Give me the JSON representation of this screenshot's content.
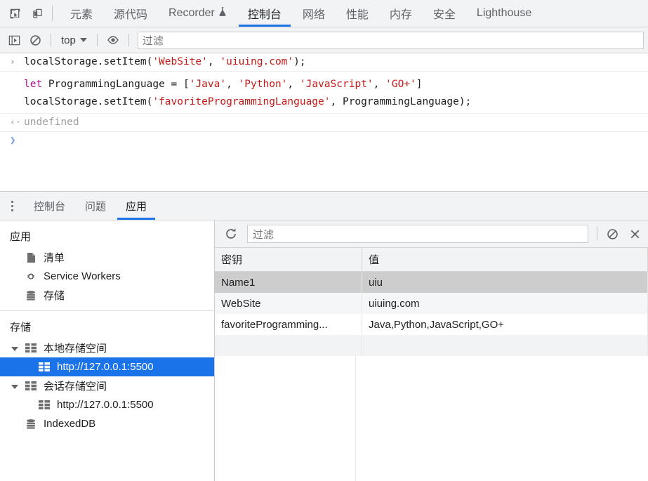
{
  "top_toolbar": {
    "inspect_icon": "inspect-cursor-icon",
    "device_icon": "device-toolbar-icon",
    "tabs": [
      {
        "label": "元素",
        "active": false
      },
      {
        "label": "源代码",
        "active": false
      },
      {
        "label": "Recorder",
        "active": false,
        "icon": "flask-experiment-icon"
      },
      {
        "label": "控制台",
        "active": true
      },
      {
        "label": "网络",
        "active": false
      },
      {
        "label": "性能",
        "active": false
      },
      {
        "label": "内存",
        "active": false
      },
      {
        "label": "安全",
        "active": false
      },
      {
        "label": "Lighthouse",
        "active": false
      }
    ]
  },
  "console_toolbar": {
    "sidebar_toggle_icon": "console-sidebar-icon",
    "clear_icon": "clear-console-icon",
    "context_value": "top",
    "eye_icon": "live-expression-eye-icon",
    "filter_placeholder": "过滤"
  },
  "console": {
    "entries": [
      {
        "kind": "input",
        "marker": "›",
        "tokens": [
          {
            "t": "localStorage.setItem(",
            "c": "plain"
          },
          {
            "t": "'WebSite'",
            "c": "str"
          },
          {
            "t": ", ",
            "c": "plain"
          },
          {
            "t": "'uiuing.com'",
            "c": "str"
          },
          {
            "t": ");",
            "c": "plain"
          }
        ]
      },
      {
        "kind": "input-multiline",
        "marker": "",
        "lines": [
          [
            {
              "t": "let",
              "c": "kw"
            },
            {
              "t": " ProgrammingLanguage = [",
              "c": "plain"
            },
            {
              "t": "'Java'",
              "c": "str"
            },
            {
              "t": ", ",
              "c": "plain"
            },
            {
              "t": "'Python'",
              "c": "str"
            },
            {
              "t": ", ",
              "c": "plain"
            },
            {
              "t": "'JavaScript'",
              "c": "str"
            },
            {
              "t": ", ",
              "c": "plain"
            },
            {
              "t": "'GO+'",
              "c": "str"
            },
            {
              "t": "]",
              "c": "plain"
            }
          ],
          [
            {
              "t": "localStorage.setItem(",
              "c": "plain"
            },
            {
              "t": "'favoriteProgrammingLanguage'",
              "c": "str"
            },
            {
              "t": ", ProgrammingLanguage);",
              "c": "plain"
            }
          ]
        ]
      },
      {
        "kind": "output",
        "marker": "‹·",
        "text": "undefined"
      }
    ],
    "prompt_marker": "❯"
  },
  "drawer": {
    "more_icon": "more-options-dots-icon",
    "tabs": [
      {
        "label": "控制台",
        "active": false
      },
      {
        "label": "问题",
        "active": false
      },
      {
        "label": "应用",
        "active": true
      }
    ]
  },
  "app_sidebar": {
    "section_application": {
      "title": "应用",
      "items": [
        {
          "label": "清单",
          "icon": "manifest-file-icon",
          "selected": false
        },
        {
          "label": "Service Workers",
          "icon": "gear-icon",
          "selected": false
        },
        {
          "label": "存储",
          "icon": "database-icon",
          "selected": false
        }
      ]
    },
    "section_storage": {
      "title": "存储",
      "items": [
        {
          "label": "本地存储空间",
          "icon": "table-grid-icon",
          "twisty": "expanded",
          "indent": 1,
          "selected": false
        },
        {
          "label": "http://127.0.0.1:5500",
          "icon": "table-grid-icon",
          "twisty": "none",
          "indent": 2,
          "selected": true
        },
        {
          "label": "会话存储空间",
          "icon": "table-grid-icon",
          "twisty": "expanded",
          "indent": 1,
          "selected": false
        },
        {
          "label": "http://127.0.0.1:5500",
          "icon": "table-grid-icon",
          "twisty": "none",
          "indent": 2,
          "selected": false
        },
        {
          "label": "IndexedDB",
          "icon": "database-icon",
          "twisty": "none",
          "indent": 1,
          "selected": false
        }
      ]
    }
  },
  "storage_table": {
    "toolbar": {
      "refresh_icon": "refresh-icon",
      "filter_placeholder": "过滤",
      "clear_all_icon": "clear-all-icon",
      "delete_selected_icon": "delete-selected-x-icon"
    },
    "columns": [
      "密钥",
      "值"
    ],
    "rows": [
      {
        "key": "Name1",
        "value": "uiu",
        "state": "selected"
      },
      {
        "key": "WebSite",
        "value": "uiuing.com",
        "state": "alt"
      },
      {
        "key": "favoriteProgramming...",
        "value": "Java,Python,JavaScript,GO+",
        "state": "normal"
      },
      {
        "key": "",
        "value": "",
        "state": "empty"
      }
    ]
  },
  "colors": {
    "accent": "#1a73e8",
    "toolbar_bg": "#f1f3f4",
    "selected_row": "#cdcdcd",
    "string_literal": "#c41a16",
    "keyword": "#aa0d91"
  }
}
